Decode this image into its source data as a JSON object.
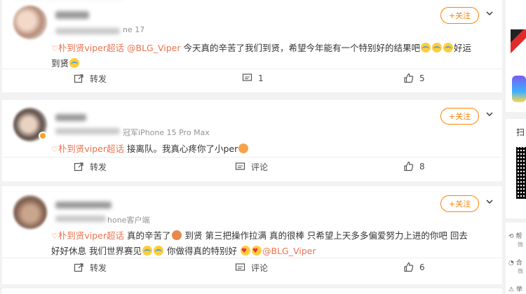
{
  "posts": [
    {
      "meta_suffix": "ne 17",
      "follow_label": "+关注",
      "topic": "朴到贤viper超话",
      "mention": "@BLG_Viper",
      "text_a": "今天真的辛苦了我们到贤，希望今年能有一个特别好的结果吧",
      "text_b": "好运",
      "text_c": "到贤",
      "repost_label": "转发",
      "comment_count": "1",
      "like_count": "5"
    },
    {
      "meta_suffix": "冠军iPhone 15 Pro Max",
      "follow_label": "+关注",
      "topic": "朴到贤viper超话",
      "text_a": "接离队。我真心疼你了小per",
      "repost_label": "转发",
      "comment_label": "评论",
      "like_count": "8"
    },
    {
      "meta_suffix": "hone客户端",
      "follow_label": "+关注",
      "topic": "朴到贤viper超话",
      "text_a": "真的辛苦了",
      "text_b": "到贤 第三把操作拉满 真的很棒 只希望上天多多偏爱努力上进的你吧 回去",
      "text_c": "好好休息 我们世界赛见",
      "text_d": "你做得真的特别好",
      "mention": "@BLG_Viper",
      "repost_label": "转发",
      "comment_label": "评论",
      "like_count": "6"
    }
  ],
  "sidebar": {
    "scan_label": "扫",
    "item1": "帮",
    "item1_sub": "微",
    "item2": "合",
    "item2_sub": "微",
    "item3": "举"
  },
  "colors": {
    "accent": "#ff8200",
    "topic": "#eb7350",
    "background": "#f2f2f2"
  },
  "icons": [
    "repost-icon",
    "comment-icon",
    "like-icon",
    "chevron-down-icon",
    "diamond-icon"
  ]
}
